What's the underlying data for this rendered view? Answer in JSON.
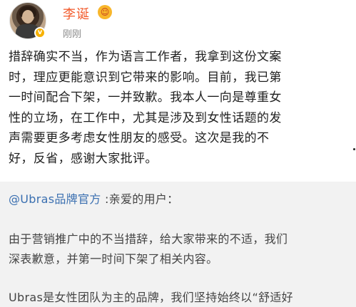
{
  "post": {
    "username": "李诞",
    "timestamp": "刚刚",
    "verified_mark": "v",
    "lines": [
      "措辞确实不当，作为语言工作者，我拿到这份文案",
      "时，理应更能意识到它带来的影响。目前，我已第",
      "一时间配合下架，一并致歉。我本人一向是尊重女",
      "性的立场，在工作中，尤其是涉及到女性话题的发",
      "声需要更多考虑女性朋友的感受。这次是我的不",
      "好，反省，感谢大家批评。"
    ]
  },
  "quote": {
    "mention": "@Ubras品牌官方",
    "greeting": " :亲爱的用户：",
    "paragraph1": [
      "由于营销推广中的不当措辞，给大家带来的不适，我们",
      "深表歉意，并第一时间下架了相关内容。"
    ],
    "paragraph2": "Ubras是女性团队为主的品牌，我们坚持始终以“舒适好"
  },
  "colors": {
    "username": "#f25a2b",
    "mention": "#3a6fb0",
    "quote_bg": "#f2f2f2",
    "badge": "#f7b100"
  },
  "icons": [
    "avatar",
    "verified-icon",
    "emoji-badge-icon"
  ]
}
